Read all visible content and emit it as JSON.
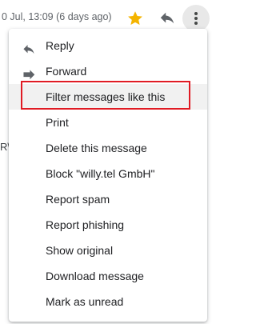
{
  "header": {
    "timestamp": "0 Jul, 13:09 (6 days ago)",
    "star_icon": "star-icon",
    "reply_icon": "reply-icon",
    "more_icon": "more-vert-icon",
    "colors": {
      "star": "#f4b400",
      "icon_gray": "#5f6368"
    }
  },
  "background": {
    "fragment_text": "R\\"
  },
  "menu": {
    "items": [
      {
        "label": "Reply",
        "icon": "reply-icon"
      },
      {
        "label": "Forward",
        "icon": "forward-icon"
      },
      {
        "label": "Filter messages like this",
        "highlighted": true
      },
      {
        "label": "Print"
      },
      {
        "label": "Delete this message"
      },
      {
        "label": "Block \"willy.tel GmbH\""
      },
      {
        "label": "Report spam"
      },
      {
        "label": "Report phishing"
      },
      {
        "label": "Show original"
      },
      {
        "label": "Download message"
      },
      {
        "label": "Mark as unread"
      }
    ],
    "annotation_color": "#e01b24"
  }
}
